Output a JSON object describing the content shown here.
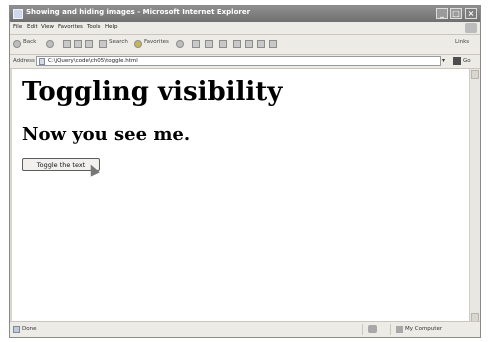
{
  "window": {
    "title": "Showing and hiding images - Microsoft Internet Explorer"
  },
  "menu": [
    "File",
    "Edit",
    "View",
    "Favorites",
    "Tools",
    "Help"
  ],
  "toolbar": {
    "back": "Back",
    "search": "Search",
    "favorites": "Favorites",
    "links": "Links"
  },
  "address": {
    "label": "Address",
    "url": "C:\\jQuery\\code\\ch05\\toggle.html",
    "go": "Go"
  },
  "page": {
    "heading1": "Toggling visibility",
    "heading2": "Now you see me.",
    "button": "Toggle the text"
  },
  "status": {
    "text": "Done",
    "zone": "My Computer"
  }
}
